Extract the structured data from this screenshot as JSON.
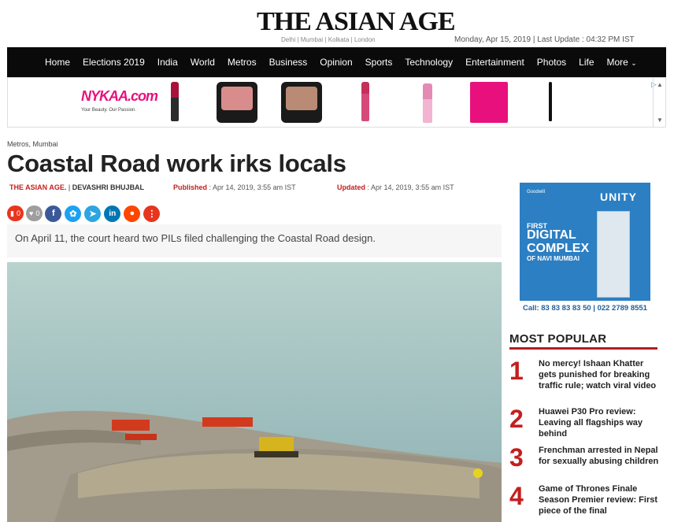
{
  "masthead": {
    "logo": "THE ASIAN AGE",
    "cities": "Delhi | Mumbai | Kolkata | London",
    "dateline": "Monday, Apr 15, 2019 | Last Update : 04:32 PM IST"
  },
  "nav": {
    "items": [
      "Home",
      "Elections 2019",
      "India",
      "World",
      "Metros",
      "Business",
      "Opinion",
      "Sports",
      "Technology",
      "Entertainment",
      "Photos",
      "Life",
      "More"
    ],
    "more_icon": "chevron-down-icon"
  },
  "ad_banner": {
    "brand": "NYKAA.com",
    "tagline": "Your Beauty. Our Passion."
  },
  "article": {
    "breadcrumb": "Metros, Mumbai",
    "headline": "Coastal Road work irks locals",
    "source": "THE ASIAN AGE.",
    "separator": "|",
    "author": "DEVASHRI BHUJBAL",
    "published_label": "Published",
    "published_value": ": Apr 14, 2019, 3:55 am IST",
    "updated_label": "Updated",
    "updated_value": ": Apr 14, 2019, 3:55 am IST",
    "comment_count": "0",
    "like_count": "0",
    "summary": "On April 11, the court heard two PILs filed challenging the Coastal Road design."
  },
  "share": {
    "icons": [
      "comment-icon",
      "heart-icon",
      "facebook-icon",
      "twitter-icon",
      "telegram-icon",
      "linkedin-icon",
      "reddit-icon",
      "more-icon"
    ],
    "colors": {
      "comment": "#e8351e",
      "like": "#9e9e9e",
      "facebook": "#3b5998",
      "twitter": "#1da1f2",
      "telegram": "#2ca5e0",
      "linkedin": "#0077b5",
      "reddit": "#ff4500",
      "more": "#e8351e"
    }
  },
  "sidebar_ad": {
    "developer": "Goodwill",
    "project": "UNITY",
    "line1": "FIRST",
    "line2": "DIGITAL COMPLEX",
    "line3": "OF NAVI MUMBAI",
    "phone": "Call: 83 83 83 83 50 | 022 2789 8551"
  },
  "most_popular": {
    "title": "MOST POPULAR",
    "items": [
      {
        "rank": "1",
        "title": "No mercy! Ishaan Khatter gets punished for breaking traffic rule; watch viral video"
      },
      {
        "rank": "2",
        "title": "Huawei P30 Pro review: Leaving all flagships way behind"
      },
      {
        "rank": "3",
        "title": "Frenchman arrested in Nepal for sexually abusing children"
      },
      {
        "rank": "4",
        "title": "Game of Thrones Finale Season Premier review: First piece of the final"
      }
    ]
  },
  "theme": {
    "accent": "#c41e1e",
    "nav_bg": "#0a0a0a"
  }
}
